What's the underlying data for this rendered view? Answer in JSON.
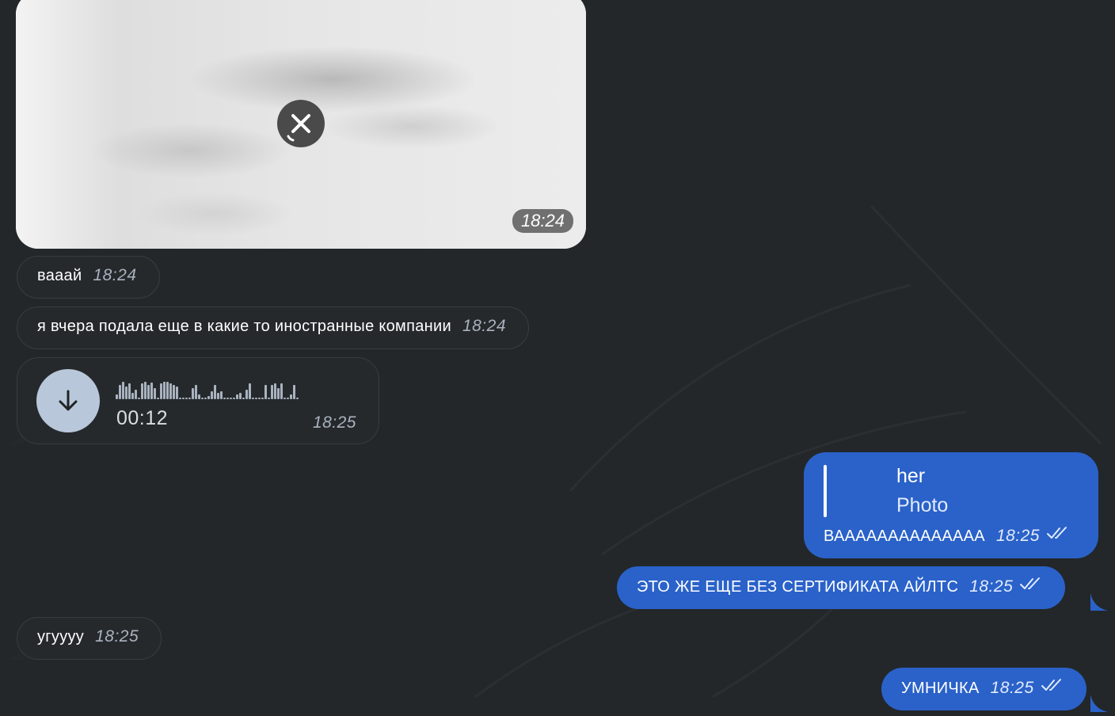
{
  "messages": {
    "photo": {
      "time": "18:24"
    },
    "m1": {
      "text": "вааай",
      "time": "18:24"
    },
    "m2": {
      "text": "я вчера подала еще в какие то иностранные компании",
      "time": "18:24"
    },
    "voice": {
      "duration": "00:12",
      "time": "18:25"
    },
    "reply": {
      "author": "her",
      "type": "Photo",
      "text": "ВАААААААААААААА",
      "time": "18:25"
    },
    "m3": {
      "text": "ЭТО ЖЕ ЕЩЕ БЕЗ СЕРТИФИКАТА АЙЛТС",
      "time": "18:25"
    },
    "m4": {
      "text": "угуууу",
      "time": "18:25"
    },
    "m5": {
      "text": "УМНИЧКА",
      "time": "18:25"
    }
  },
  "colors": {
    "background": "#23272a",
    "incoming": "#26292c",
    "outgoing": "#2a62c9"
  },
  "icons": [
    "cancel-download-icon",
    "download-icon",
    "double-check-icon"
  ]
}
